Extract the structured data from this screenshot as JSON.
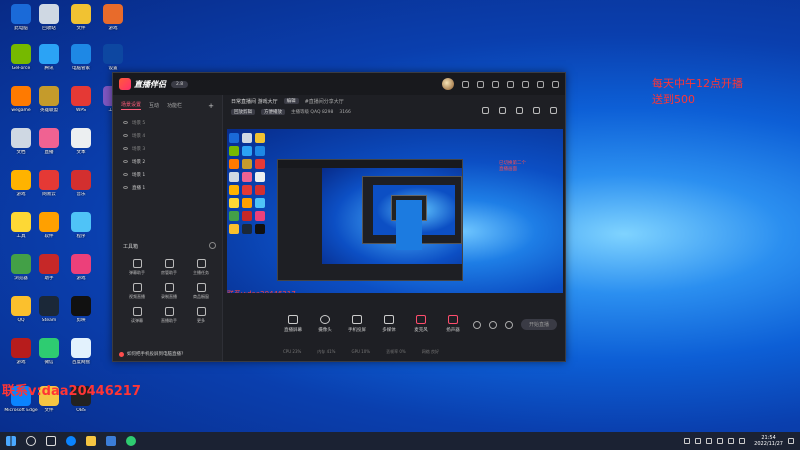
{
  "desktop": {
    "contact_text": "联系v:daa20446217",
    "overlay_text_line1": "每天中午12点开播",
    "overlay_text_line2": "送到500"
  },
  "app": {
    "name": "直播伴侣",
    "version_badge": "2.8",
    "sidebar": {
      "tabs": [
        "场景设置",
        "互动",
        "功能栏"
      ],
      "add_label": "+",
      "scenes": [
        "场景 5",
        "场景 4",
        "场景 3",
        "场景 2",
        "场景 1",
        "直播 1"
      ],
      "tools_header": "工具箱",
      "tools": [
        "弹幕助手",
        "房管助手",
        "主播任务",
        "视频直播",
        "录制直播",
        "商品橱窗",
        "读弹幕",
        "直播助手",
        "更多"
      ],
      "hint": "如何把手机投屏到电脑直播?"
    },
    "info": {
      "title": "日常直播间 游戏大厅",
      "tag1": "编辑",
      "tag2": "#直播间分享大厅",
      "tag_left": "回放剪辑",
      "tag_mid": "方便播放",
      "subtext": "主播等级 QAQ 8298",
      "fans": "3166"
    },
    "preview": {
      "contact": "联系v:daa20446217",
      "note_line1": "已切换第二个",
      "note_line2": "直播画面"
    },
    "bottom_tools": [
      "直播屏幕",
      "摄像头",
      "手机投屏",
      "多媒体",
      "麦克风",
      "扬声器"
    ],
    "go_live": "开始直播",
    "stats": [
      "CPU 23%",
      "内存 41%",
      "GPU 10%",
      "丢帧率 0%",
      "网络 良好"
    ]
  },
  "taskbar": {
    "time": "21:54",
    "date": "2022/11/27"
  }
}
